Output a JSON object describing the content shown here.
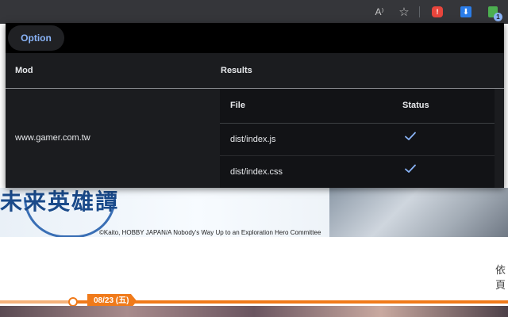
{
  "toolbar": {
    "icons": [
      "read-aloud-icon",
      "bookmark-star-icon",
      "shield-extension-icon",
      "download-extension-icon",
      "mod-extension-icon"
    ],
    "read_aloud_glyph": "A⁾",
    "star_glyph": "☆",
    "shield_badge": "!",
    "download_glyph": "⬇",
    "mod_badge": "1"
  },
  "popup": {
    "option_label": "Option",
    "columns": {
      "mod": "Mod",
      "results": "Results"
    },
    "mod_value": "www.gamer.com.tw",
    "results_table": {
      "columns": {
        "file": "File",
        "status": "Status"
      },
      "rows": [
        {
          "file": "dist/index.js",
          "status": "check-icon"
        },
        {
          "file": "dist/index.css",
          "status": "check-icon"
        }
      ]
    },
    "colors": {
      "accent": "#8ab4f8",
      "surface": "#1b1c1f",
      "header": "#000000"
    }
  },
  "background": {
    "banner_title": "未来英雄譚",
    "copyright": "©Kaito, HOBBY JAPAN/A Nobody's Way Up to an Exploration Hero Committee",
    "side_text": "依頁",
    "date_tag": "08/23 (五)",
    "timeline_color": "#f07a1a"
  }
}
